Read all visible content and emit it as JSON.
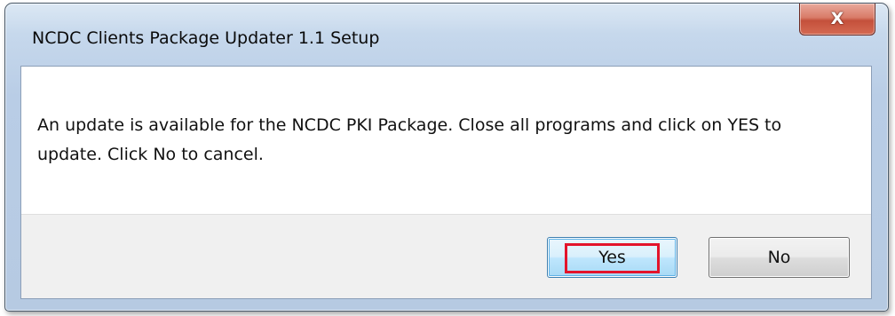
{
  "window": {
    "title": "NCDC Clients Package Updater 1.1 Setup",
    "close_icon": "close-x-icon",
    "close_glyph": "X"
  },
  "dialog": {
    "message": "An update is available for the NCDC PKI Package. Close all programs and click on YES to update. Click No to cancel."
  },
  "buttons": {
    "yes_label": "Yes",
    "no_label": "No"
  },
  "annotation": {
    "highlight_color": "#e3142b",
    "highlight_target": "Yes"
  }
}
